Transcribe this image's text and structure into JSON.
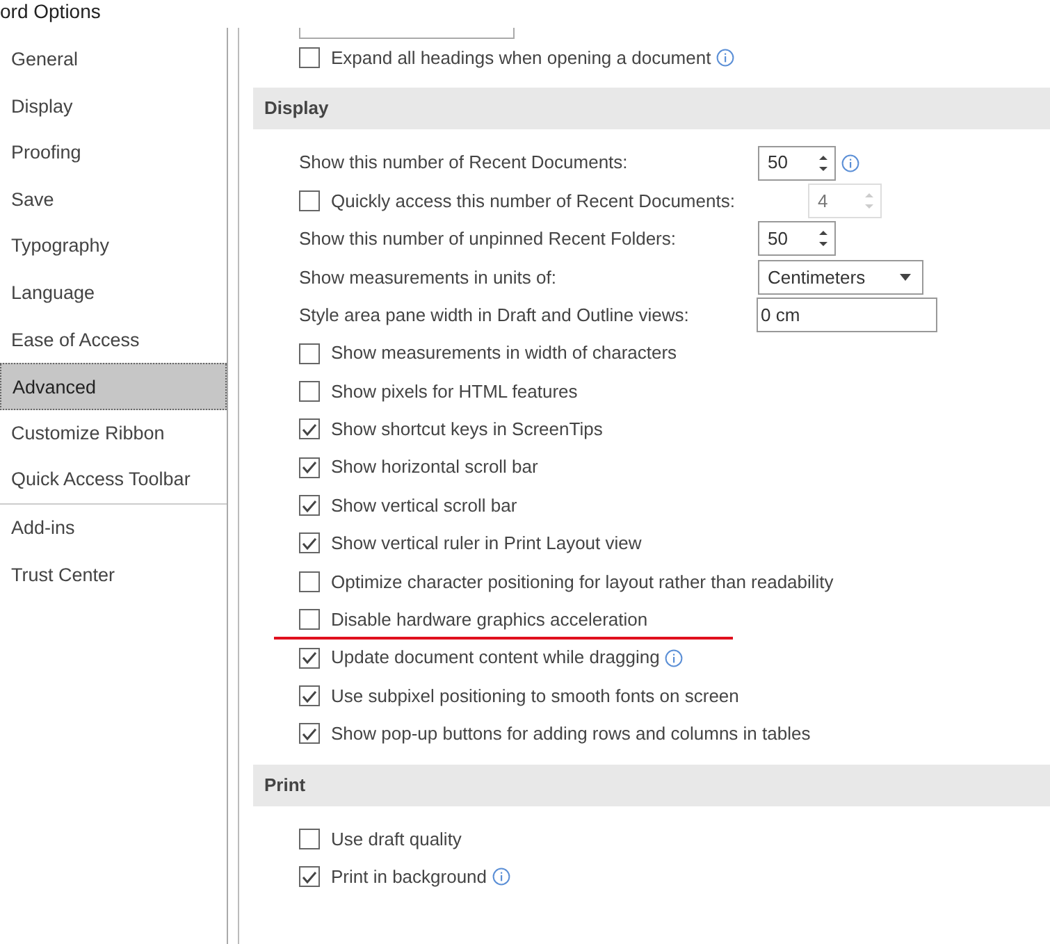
{
  "window": {
    "title": "ord Options"
  },
  "sidebar": {
    "groups": [
      [
        {
          "label": "General",
          "selected": false
        },
        {
          "label": "Display",
          "selected": false
        },
        {
          "label": "Proofing",
          "selected": false
        },
        {
          "label": "Save",
          "selected": false
        },
        {
          "label": "Typography",
          "selected": false
        },
        {
          "label": "Language",
          "selected": false
        },
        {
          "label": "Ease of Access",
          "selected": false
        },
        {
          "label": "Advanced",
          "selected": true
        },
        {
          "label": "Customize Ribbon",
          "selected": false
        },
        {
          "label": "Quick Access Toolbar",
          "selected": false
        }
      ],
      [
        {
          "label": "Add-ins",
          "selected": false
        },
        {
          "label": "Trust Center",
          "selected": false
        }
      ]
    ]
  },
  "sections": [
    {
      "items": [
        {
          "kind": "checkbox",
          "label": "Expand all headings when opening a document",
          "checked": false,
          "info": true
        }
      ]
    },
    {
      "title": "Display",
      "items": [
        {
          "kind": "spin",
          "label": "Show this number of Recent Documents:",
          "value": "50",
          "info": true,
          "disabled": false
        },
        {
          "kind": "checkspin",
          "label": "Quickly access this number of Recent Documents:",
          "checked": false,
          "value": "4",
          "disabled": true
        },
        {
          "kind": "spin",
          "label": "Show this number of unpinned Recent Folders:",
          "value": "50",
          "disabled": false
        },
        {
          "kind": "dropdown",
          "label": "Show measurements in units of:",
          "value": "Centimeters"
        },
        {
          "kind": "text",
          "label": "Style area pane width in Draft and Outline views:",
          "value": "0 cm"
        },
        {
          "kind": "checkbox",
          "label": "Show measurements in width of characters",
          "checked": false
        },
        {
          "kind": "checkbox",
          "label": "Show pixels for HTML features",
          "checked": false
        },
        {
          "kind": "checkbox",
          "label": "Show shortcut keys in ScreenTips",
          "checked": true
        },
        {
          "kind": "checkbox",
          "label": "Show horizontal scroll bar",
          "checked": true
        },
        {
          "kind": "checkbox",
          "label": "Show vertical scroll bar",
          "checked": true
        },
        {
          "kind": "checkbox",
          "label": "Show vertical ruler in Print Layout view",
          "checked": true
        },
        {
          "kind": "checkbox",
          "label": "Optimize character positioning for layout rather than readability",
          "checked": false
        },
        {
          "kind": "checkbox",
          "label": "Disable hardware graphics acceleration",
          "checked": false,
          "highlighted": true
        },
        {
          "kind": "checkbox",
          "label": "Update document content while dragging",
          "checked": true,
          "info": true
        },
        {
          "kind": "checkbox",
          "label": "Use subpixel positioning to smooth fonts on screen",
          "checked": true
        },
        {
          "kind": "checkbox",
          "label": "Show pop-up buttons for adding rows and columns in tables",
          "checked": true
        }
      ]
    },
    {
      "title": "Print",
      "items": [
        {
          "kind": "checkbox",
          "label": "Use draft quality",
          "checked": false
        },
        {
          "kind": "checkbox",
          "label": "Print in background",
          "checked": true,
          "info": true
        }
      ]
    }
  ]
}
